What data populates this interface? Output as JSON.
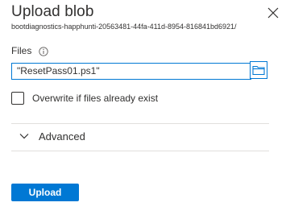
{
  "panel": {
    "title": "Upload blob",
    "subtitle": "bootdiagnostics-happhunti-20563481-44fa-411d-8954-816841bd6921/",
    "close_icon": "close-icon"
  },
  "files": {
    "label": "Files",
    "info_icon": "info-icon",
    "value": "\"ResetPass01.ps1\"",
    "browse_icon": "folder-icon"
  },
  "overwrite": {
    "label": "Overwrite if files already exist",
    "checked": false
  },
  "advanced": {
    "label": "Advanced",
    "icon": "chevron-down-icon",
    "expanded": false
  },
  "actions": {
    "upload_label": "Upload"
  },
  "colors": {
    "accent": "#0078d4",
    "text": "#323130",
    "divider": "#e1dfdd"
  }
}
